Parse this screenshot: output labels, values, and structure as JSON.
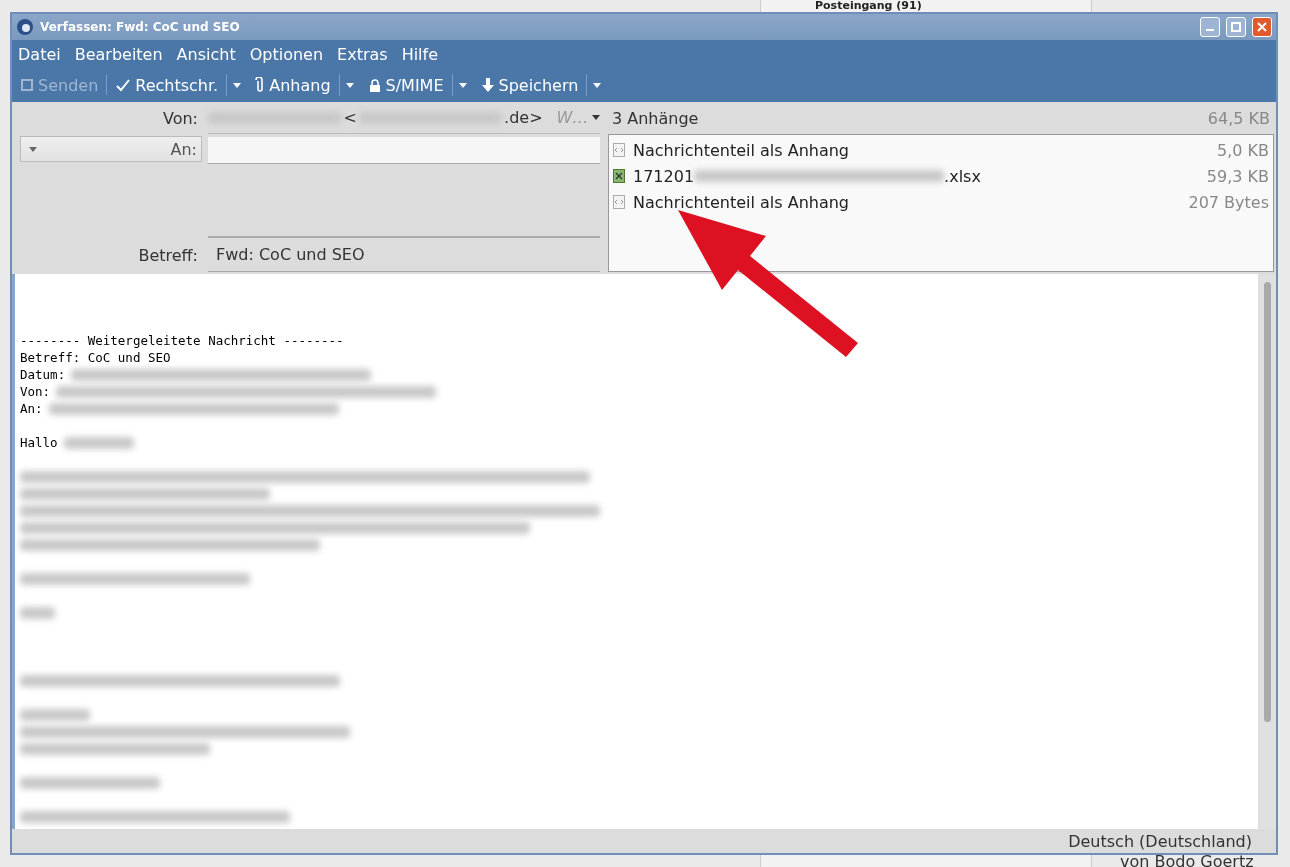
{
  "background": {
    "folder": "Posteingang (91)",
    "sender": "von Bodo Goertz"
  },
  "window": {
    "title": "Verfassen: Fwd: CoC und SEO"
  },
  "menu": [
    "Datei",
    "Bearbeiten",
    "Ansicht",
    "Optionen",
    "Extras",
    "Hilfe"
  ],
  "toolbar": [
    {
      "kind": "send",
      "label": "Senden",
      "disabled": true,
      "dropdown": false
    },
    {
      "kind": "spell",
      "label": "Rechtschr.",
      "disabled": false,
      "dropdown": true
    },
    {
      "kind": "attach",
      "label": "Anhang",
      "disabled": false,
      "dropdown": true
    },
    {
      "kind": "lock",
      "label": "S/MIME",
      "disabled": false,
      "dropdown": true
    },
    {
      "kind": "save",
      "label": "Speichern",
      "disabled": false,
      "dropdown": true
    }
  ],
  "header": {
    "from": {
      "label": "Von:",
      "address_open": "<",
      "address_end": ".de>",
      "identity": "W…"
    },
    "to": {
      "label": "An:"
    },
    "subject": {
      "label": "Betreff:",
      "value": "Fwd: CoC und SEO"
    }
  },
  "attachments": {
    "title": "3 Anhänge",
    "total": "64,5 KB",
    "items": [
      {
        "kind": "part",
        "name": "Nachrichtenteil als Anhang",
        "size": "5,0 KB"
      },
      {
        "kind": "sheet",
        "name": "171201",
        "suffix": ".xlsx",
        "size": "59,3 KB"
      },
      {
        "kind": "part",
        "name": "Nachrichtenteil als Anhang",
        "size": "207 Bytes"
      }
    ]
  },
  "body": [
    {
      "kind": "text",
      "text": "-------- Weitergeleitete Nachricht --------",
      "redacted": false
    },
    {
      "kind": "text",
      "text": "Betreff: CoC und SEO",
      "redacted": false
    },
    {
      "kind": "text",
      "text": "Datum:",
      "redacted": true
    },
    {
      "kind": "text",
      "text": "Von:",
      "redacted": true
    },
    {
      "kind": "text",
      "text": "An:",
      "redacted": true
    },
    {
      "kind": "blank"
    },
    {
      "kind": "text",
      "text": "Hallo",
      "redacted": true
    },
    {
      "kind": "blank"
    },
    {
      "kind": "redacted"
    },
    {
      "kind": "redacted"
    },
    {
      "kind": "redacted"
    },
    {
      "kind": "redacted"
    },
    {
      "kind": "redacted"
    },
    {
      "kind": "blank"
    },
    {
      "kind": "redacted"
    },
    {
      "kind": "blank"
    },
    {
      "kind": "redacted"
    },
    {
      "kind": "blank"
    },
    {
      "kind": "blank"
    },
    {
      "kind": "blank"
    },
    {
      "kind": "redacted"
    },
    {
      "kind": "blank"
    },
    {
      "kind": "redacted"
    },
    {
      "kind": "redacted"
    },
    {
      "kind": "redacted"
    },
    {
      "kind": "blank"
    },
    {
      "kind": "redacted"
    },
    {
      "kind": "blank"
    },
    {
      "kind": "redacted"
    }
  ],
  "status_bar": {
    "language": "Deutsch (Deutschland)"
  }
}
